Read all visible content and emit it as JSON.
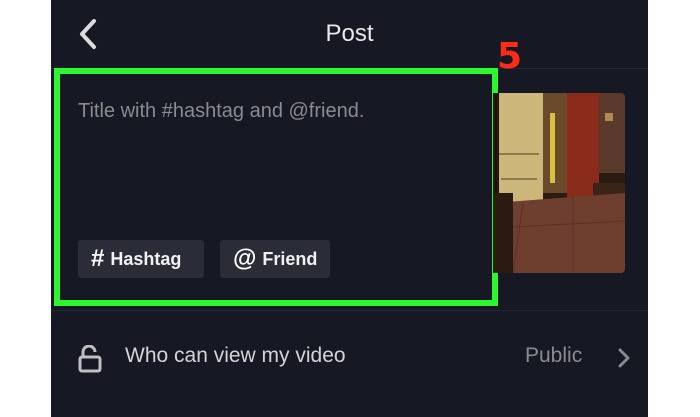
{
  "header": {
    "title": "Post",
    "back_icon": "chevron-left-icon"
  },
  "annotation": {
    "step": "5",
    "color": "#ff2a1a"
  },
  "caption": {
    "placeholder": "Title with #hashtag and @friend.",
    "highlight_color": "#2cf532",
    "chips": [
      {
        "icon": "#",
        "label": "Hashtag"
      },
      {
        "icon": "@",
        "label": "Friend"
      }
    ]
  },
  "privacy": {
    "label": "Who can view my video",
    "value": "Public",
    "icon": "unlock-icon"
  },
  "colors": {
    "background": "#161823",
    "chip": "#2a2c37",
    "text": "#e8e8ea",
    "muted": "#8a8b91"
  }
}
